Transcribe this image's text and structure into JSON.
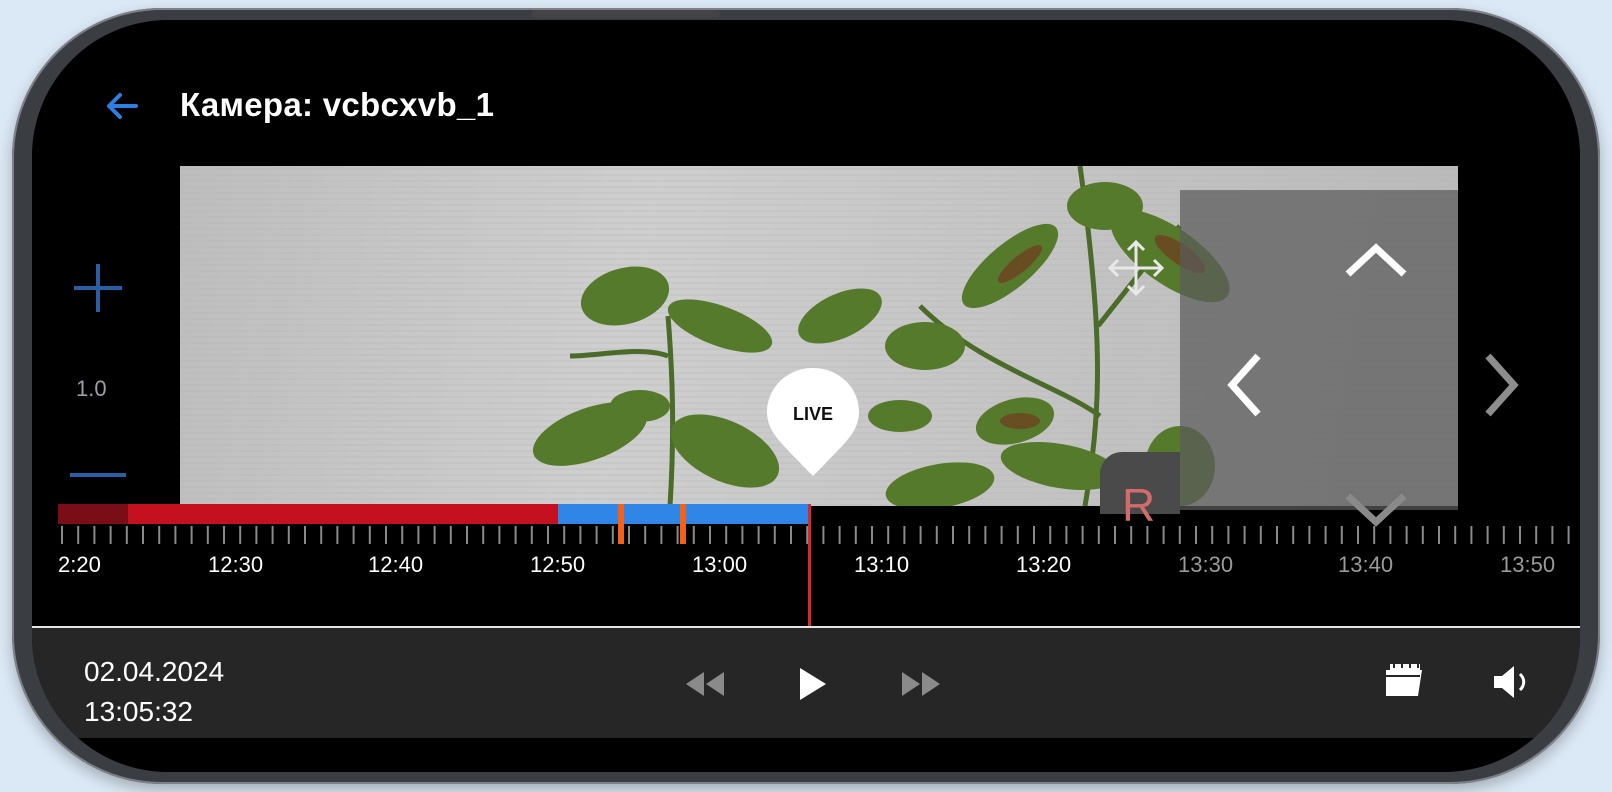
{
  "header": {
    "title": "Камера: vcbcxvb_1"
  },
  "zoom": {
    "level": "1.0"
  },
  "video": {
    "live_label": "LIVE",
    "recording_letter": "R"
  },
  "timeline": {
    "labels": [
      {
        "text": "2:20",
        "dim": false
      },
      {
        "text": "12:30",
        "dim": false
      },
      {
        "text": "12:40",
        "dim": false
      },
      {
        "text": "12:50",
        "dim": false
      },
      {
        "text": "13:00",
        "dim": false
      },
      {
        "text": "13:10",
        "dim": false
      },
      {
        "text": "13:20",
        "dim": false
      },
      {
        "text": "13:30",
        "dim": true
      },
      {
        "text": "13:40",
        "dim": true
      },
      {
        "text": "13:50",
        "dim": true
      }
    ],
    "colors": {
      "alarm_recording": "#c4101f",
      "recording": "#2f86e6",
      "event": "#f2621b",
      "playhead": "#d8282e"
    }
  },
  "controls": {
    "date": "02.04.2024",
    "time": "13:05:32"
  },
  "icons": {
    "back": "arrow-left-icon",
    "zoom_in": "plus-icon",
    "zoom_out": "minus-icon",
    "move": "move-arrows-icon",
    "up": "chevron-up-icon",
    "down": "chevron-down-icon",
    "left": "chevron-left-icon",
    "right": "chevron-right-icon",
    "rewind": "rewind-icon",
    "play": "play-icon",
    "forward": "fast-forward-icon",
    "calendar": "calendar-icon",
    "sound": "volume-icon"
  }
}
